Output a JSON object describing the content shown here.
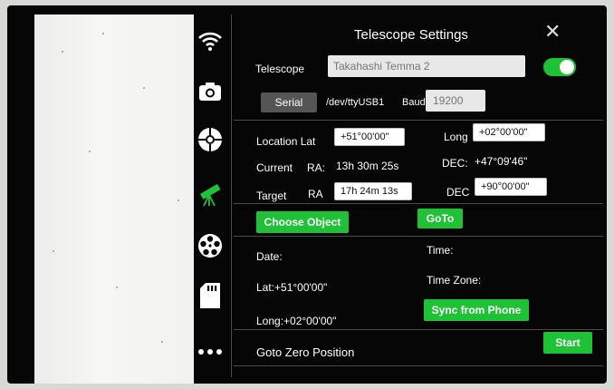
{
  "toolbar": {
    "icons": [
      "wifi-icon",
      "camera-icon",
      "crosshair-icon",
      "telescope-icon",
      "filter-wheel-icon",
      "sd-card-icon",
      "more-icon"
    ],
    "active_color": "#1fc236"
  },
  "panel": {
    "title": "Telescope Settings",
    "telescope_label": "Telescope",
    "telescope_placeholder": "Takahashi Temma 2",
    "enabled": true,
    "serial_label": "Serial",
    "port": "/dev/ttyUSB1",
    "baud_label": "Baud",
    "baud_placeholder": "19200",
    "location_lat_label": "Location Lat",
    "location_lat_value": "+51°00'00\"",
    "long_label": "Long",
    "long_value": "+02°00'00\"",
    "current_label": "Current",
    "ra_label": "RA:",
    "current_ra": "13h 30m 25s",
    "dec_label": "DEC:",
    "current_dec": "+47°09'46\"",
    "target_label": "Target",
    "target_ra_label": "RA",
    "target_ra": "17h 24m 13s",
    "target_dec_label": "DEC",
    "target_dec": "+90°00'00\"",
    "choose_object": "Choose Object",
    "goto": "GoTo",
    "date_label": "Date:",
    "time_label": "Time:",
    "lat_text": "Lat:+51°00'00\"",
    "timezone_label": "Time Zone:",
    "long_text": "Long:+02°00'00\"",
    "sync_from_phone": "Sync from Phone",
    "goto_zero": "Goto Zero Position",
    "start": "Start",
    "accent": "#1fc236"
  }
}
